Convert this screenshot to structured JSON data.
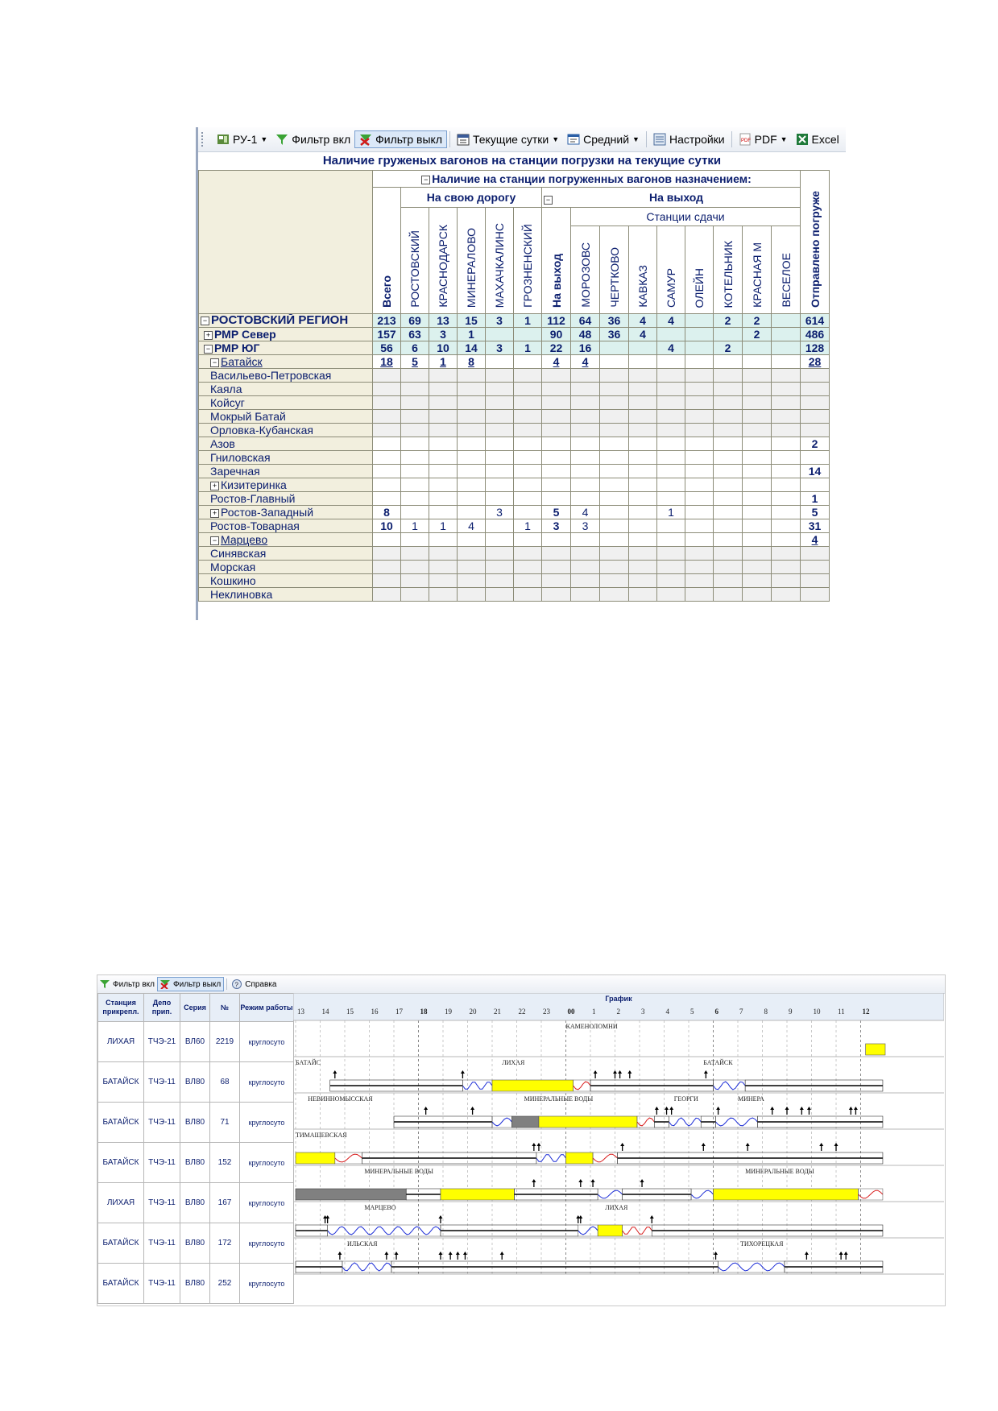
{
  "top": {
    "toolbar": [
      {
        "label": "РУ-1",
        "icon": "report-icon",
        "dropdown": true
      },
      {
        "label": "Фильтр вкл",
        "icon": "filter-on-icon",
        "dropdown": false
      },
      {
        "label": "Фильтр выкл",
        "icon": "filter-off-icon",
        "dropdown": false,
        "pressed": true
      },
      {
        "label": "Текущие сутки",
        "icon": "calendar-icon",
        "dropdown": true
      },
      {
        "label": "Средний",
        "icon": "font-size-icon",
        "dropdown": true
      },
      {
        "label": "Настройки",
        "icon": "settings-icon",
        "dropdown": false
      },
      {
        "label": "PDF",
        "icon": "pdf-icon",
        "dropdown": true
      },
      {
        "label": "Excel",
        "icon": "excel-icon",
        "dropdown": false
      }
    ],
    "title": "Наличие груженых вагонов на станции погрузки на текущие сутки",
    "group_header": "Наличие на станции погруженных вагонов назначением:",
    "own_road": "На свою дорогу",
    "exit": "На выход",
    "stations": "Станции сдачи",
    "sent": "Отправлено погруже",
    "columns": [
      "Всего",
      "РОСТОВСКИЙ",
      "КРАСНОДАРСК",
      "МИНЕРАЛОВО",
      "МАХАЧКАЛИНС",
      "ГРОЗНЕНСКИЙ",
      "На выход",
      "МОРОЗОВС",
      "ЧЕРТКОВО",
      "КАВКАЗ",
      "САМУР",
      "ОЛЕЙН",
      "КОТЕЛЬНИК",
      "КРАСНАЯ М",
      "ВЕСЕЛОЕ",
      "Отправлено погруже"
    ],
    "rows": [
      {
        "name": "РОСТОВСКИЙ РЕГИОН",
        "level": 0,
        "toggle": "⊟",
        "style": "teal",
        "cells": [
          "213",
          "69",
          "13",
          "15",
          "3",
          "1",
          "112",
          "64",
          "36",
          "4",
          "4",
          "",
          "2",
          "2",
          "",
          "614"
        ]
      },
      {
        "name": "РМР Север",
        "level": 1,
        "toggle": "⊞",
        "style": "teal",
        "cells": [
          "157",
          "63",
          "3",
          "1",
          "",
          "",
          "90",
          "48",
          "36",
          "4",
          "",
          "",
          "",
          "2",
          "",
          "486"
        ]
      },
      {
        "name": "РМР ЮГ",
        "level": 1,
        "toggle": "⊟",
        "style": "teal",
        "cells": [
          "56",
          "6",
          "10",
          "14",
          "3",
          "1",
          "22",
          "16",
          "",
          "",
          "4",
          "",
          "2",
          "",
          "",
          "128"
        ]
      },
      {
        "name": "Батайск",
        "level": 2,
        "toggle": "⊟",
        "style": "white",
        "underline": true,
        "cells": [
          "18",
          "5",
          "1",
          "8",
          "",
          "",
          "4",
          "4",
          "",
          "",
          "",
          "",
          "",
          "",
          "",
          "28"
        ]
      },
      {
        "name": "Васильево-Петровская",
        "level": 3,
        "style": "gray",
        "cells": [
          "",
          "",
          "",
          "",
          "",
          "",
          "",
          "",
          "",
          "",
          "",
          "",
          "",
          "",
          "",
          ""
        ]
      },
      {
        "name": "Каяла",
        "level": 3,
        "style": "gray",
        "cells": [
          "",
          "",
          "",
          "",
          "",
          "",
          "",
          "",
          "",
          "",
          "",
          "",
          "",
          "",
          "",
          ""
        ]
      },
      {
        "name": "Койсуг",
        "level": 3,
        "style": "gray",
        "cells": [
          "",
          "",
          "",
          "",
          "",
          "",
          "",
          "",
          "",
          "",
          "",
          "",
          "",
          "",
          "",
          ""
        ]
      },
      {
        "name": "Мокрый Батай",
        "level": 3,
        "style": "gray",
        "cells": [
          "",
          "",
          "",
          "",
          "",
          "",
          "",
          "",
          "",
          "",
          "",
          "",
          "",
          "",
          "",
          ""
        ]
      },
      {
        "name": "Орловка-Кубанская",
        "level": 3,
        "style": "gray",
        "cells": [
          "",
          "",
          "",
          "",
          "",
          "",
          "",
          "",
          "",
          "",
          "",
          "",
          "",
          "",
          "",
          ""
        ]
      },
      {
        "name": "Азов",
        "level": 3,
        "style": "white",
        "cells": [
          "",
          "",
          "",
          "",
          "",
          "",
          "",
          "",
          "",
          "",
          "",
          "",
          "",
          "",
          "",
          "2"
        ]
      },
      {
        "name": "Гниловская",
        "level": 3,
        "style": "white",
        "cells": [
          "",
          "",
          "",
          "",
          "",
          "",
          "",
          "",
          "",
          "",
          "",
          "",
          "",
          "",
          "",
          ""
        ]
      },
      {
        "name": "Заречная",
        "level": 3,
        "style": "white",
        "cells": [
          "",
          "",
          "",
          "",
          "",
          "",
          "",
          "",
          "",
          "",
          "",
          "",
          "",
          "",
          "",
          "14"
        ]
      },
      {
        "name": "Кизитеринка",
        "level": 3,
        "toggle": "⊞",
        "style": "white",
        "cells": [
          "",
          "",
          "",
          "",
          "",
          "",
          "",
          "",
          "",
          "",
          "",
          "",
          "",
          "",
          "",
          ""
        ]
      },
      {
        "name": "Ростов-Главный",
        "level": 3,
        "style": "white",
        "cells": [
          "",
          "",
          "",
          "",
          "",
          "",
          "",
          "",
          "",
          "",
          "",
          "",
          "",
          "",
          "",
          "1"
        ]
      },
      {
        "name": "Ростов-Западный",
        "level": 3,
        "toggle": "⊞",
        "style": "white",
        "cells": [
          "8",
          "",
          "",
          "",
          "3",
          "",
          "5",
          "4",
          "",
          "",
          "1",
          "",
          "",
          "",
          "",
          "5"
        ],
        "normal": [
          4,
          7,
          10
        ]
      },
      {
        "name": "Ростов-Товарная",
        "level": 3,
        "style": "white",
        "cells": [
          "10",
          "1",
          "1",
          "4",
          "",
          "1",
          "3",
          "3",
          "",
          "",
          "",
          "",
          "",
          "",
          "",
          "31"
        ],
        "normal": [
          1,
          2,
          3,
          5,
          7
        ]
      },
      {
        "name": "Марцево",
        "level": 2,
        "toggle": "⊟",
        "style": "white",
        "underline": true,
        "cells": [
          "",
          "",
          "",
          "",
          "",
          "",
          "",
          "",
          "",
          "",
          "",
          "",
          "",
          "",
          "",
          "4"
        ]
      },
      {
        "name": "Синявская",
        "level": 3,
        "style": "gray",
        "cells": [
          "",
          "",
          "",
          "",
          "",
          "",
          "",
          "",
          "",
          "",
          "",
          "",
          "",
          "",
          "",
          ""
        ]
      },
      {
        "name": "Морская",
        "level": 3,
        "style": "gray",
        "cells": [
          "",
          "",
          "",
          "",
          "",
          "",
          "",
          "",
          "",
          "",
          "",
          "",
          "",
          "",
          "",
          ""
        ]
      },
      {
        "name": "Кошкино",
        "level": 3,
        "style": "gray",
        "cells": [
          "",
          "",
          "",
          "",
          "",
          "",
          "",
          "",
          "",
          "",
          "",
          "",
          "",
          "",
          "",
          ""
        ]
      },
      {
        "name": "Неклиновка",
        "level": 3,
        "style": "gray",
        "cells": [
          "",
          "",
          "",
          "",
          "",
          "",
          "",
          "",
          "",
          "",
          "",
          "",
          "",
          "",
          "",
          ""
        ]
      }
    ]
  },
  "bottom": {
    "toolbar": [
      {
        "label": "Фильтр вкл",
        "icon": "filter-on-icon"
      },
      {
        "label": "Фильтр выкл",
        "icon": "filter-off-icon",
        "pressed": true
      },
      {
        "label": "Справка",
        "icon": "help-icon"
      }
    ],
    "headers": [
      "Станция прикрепл.",
      "Депо прип.",
      "Серия",
      "№",
      "Режим работы"
    ],
    "graph_title": "График",
    "hours": [
      "13",
      "14",
      "15",
      "16",
      "17",
      "18",
      "19",
      "20",
      "21",
      "22",
      "23",
      "00",
      "1",
      "2",
      "3",
      "4",
      "5",
      "6",
      "7",
      "8",
      "9",
      "10",
      "11",
      "12"
    ],
    "rows": [
      {
        "station": "ЛИХАЯ",
        "depot": "ТЧЭ-21",
        "series": "ВЛ60",
        "num": "2219",
        "mode": "круглосуто",
        "labels": [
          "КАМЕНОЛОМНИ"
        ]
      },
      {
        "station": "БАТАЙСК",
        "depot": "ТЧЭ-11",
        "series": "ВЛ80",
        "num": "68",
        "mode": "круглосуто",
        "labels": [
          "БАТАЙС",
          "ЛИХАЯ",
          "БАТАЙСК"
        ]
      },
      {
        "station": "БАТАЙСК",
        "depot": "ТЧЭ-11",
        "series": "ВЛ80",
        "num": "71",
        "mode": "круглосуто",
        "labels": [
          "НЕВИННОМЫССКАЯ",
          "МИНЕРАЛЬНЫЕ ВОДЫ",
          "ГЕОРГИ",
          "МИНЕРА"
        ]
      },
      {
        "station": "БАТАЙСК",
        "depot": "ТЧЭ-11",
        "series": "ВЛ80",
        "num": "152",
        "mode": "круглосуто",
        "labels": [
          "ТИМАШЕВСКАЯ"
        ]
      },
      {
        "station": "ЛИХАЯ",
        "depot": "ТЧЭ-11",
        "series": "ВЛ80",
        "num": "167",
        "mode": "круглосуто",
        "labels": [
          "МИНЕРАЛЬНЫЕ ВОДЫ",
          "МИНЕРАЛЬНЫЕ ВОДЫ"
        ]
      },
      {
        "station": "БАТАЙСК",
        "depot": "ТЧЭ-11",
        "series": "ВЛ80",
        "num": "172",
        "mode": "круглосуто",
        "labels": [
          "МАРЦЕВО",
          "ЛИХАЯ"
        ]
      },
      {
        "station": "БАТАЙСК",
        "depot": "ТЧЭ-11",
        "series": "ВЛ80",
        "num": "252",
        "mode": "круглосуто",
        "labels": [
          "ИЛЬСКАЯ",
          "ТИХОРЕЦКАЯ"
        ]
      }
    ]
  }
}
